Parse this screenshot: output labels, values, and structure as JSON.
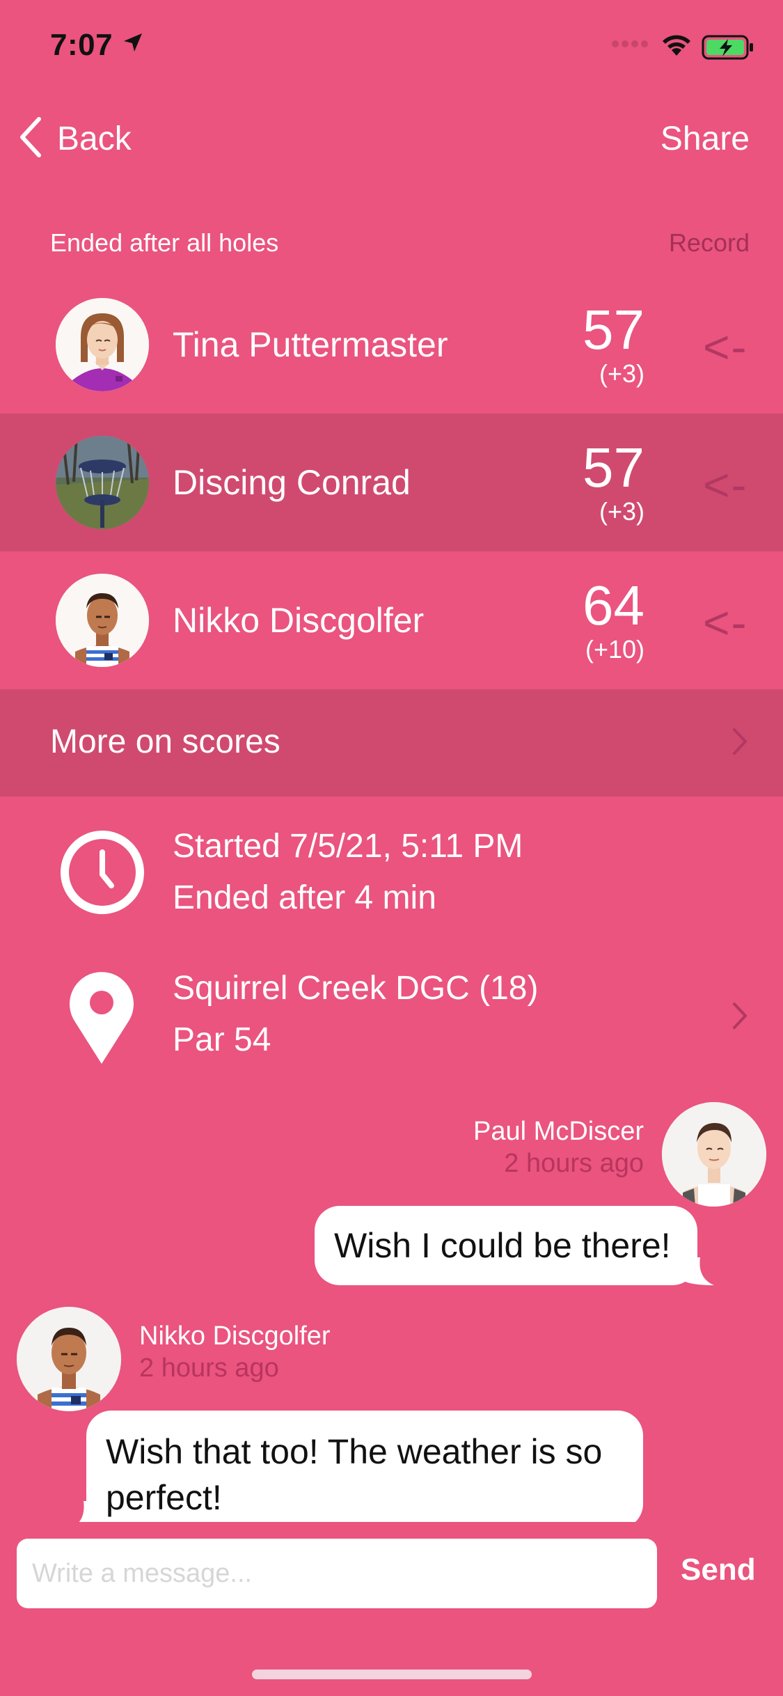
{
  "status_bar": {
    "time": "7:07"
  },
  "nav": {
    "back_label": "Back",
    "share_label": "Share"
  },
  "scores_header": {
    "title": "Ended after all holes",
    "record_label": "Record"
  },
  "players": [
    {
      "name": "Tina Puttermaster",
      "score": "57",
      "diff": "(+3)",
      "arrow": "<-",
      "avatar": "woman-avatar"
    },
    {
      "name": "Discing Conrad",
      "score": "57",
      "diff": "(+3)",
      "arrow": "<-",
      "avatar": "basket-photo-avatar"
    },
    {
      "name": "Nikko Discgolfer",
      "score": "64",
      "diff": "(+10)",
      "arrow": "<-",
      "avatar": "man-avatar"
    }
  ],
  "more": {
    "label": "More on scores"
  },
  "round_info": {
    "started": "Started 7/5/21, 5:11 PM",
    "ended": "Ended after 4 min"
  },
  "course": {
    "name": "Squirrel Creek DGC (18)",
    "par": "Par 54"
  },
  "messages": [
    {
      "author": "Paul McDiscer",
      "time": "2 hours ago",
      "text": "Wish I could be there!"
    },
    {
      "author": "Nikko Discgolfer",
      "time": "2 hours ago",
      "text": "Wish that too! The weather is so perfect!"
    }
  ],
  "composer": {
    "placeholder": "Write a message...",
    "send_label": "Send"
  },
  "colors": {
    "background": "#ea547f",
    "highlight": "#d04a6f",
    "accent": "#b23862"
  }
}
